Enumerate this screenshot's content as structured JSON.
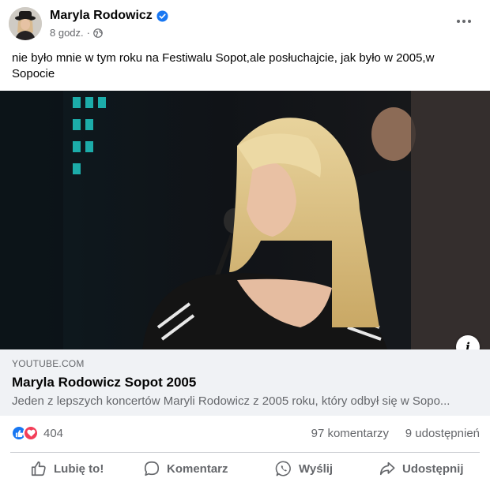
{
  "post": {
    "author": "Maryla Rodowicz",
    "time": "8 godz.",
    "separator": "·",
    "text": "nie było mnie w tym roku na Festiwalu Sopot,ale posłuchajcie, jak było w 2005,w Sopocie",
    "audience_icon": "globe-icon",
    "verified_icon": "verified-badge-icon"
  },
  "link_preview": {
    "domain": "YOUTUBE.COM",
    "title": "Maryla Rodowicz Sopot 2005",
    "description": "Jeden z lepszych koncertów Maryli Rodowicz z 2005 roku, który odbył się w Sopo..."
  },
  "stats": {
    "reaction_count": "404",
    "comments": "97 komentarzy",
    "shares": "9 udostępnień",
    "reaction_icons": [
      "like-icon",
      "love-icon"
    ]
  },
  "actions": {
    "like": "Lubię to!",
    "comment": "Komentarz",
    "send": "Wyślij",
    "share": "Udostępnij"
  },
  "colors": {
    "brand_blue": "#1877f2",
    "love_red": "#f33e58",
    "secondary_text": "#65676b",
    "card_background": "#f0f2f5"
  }
}
